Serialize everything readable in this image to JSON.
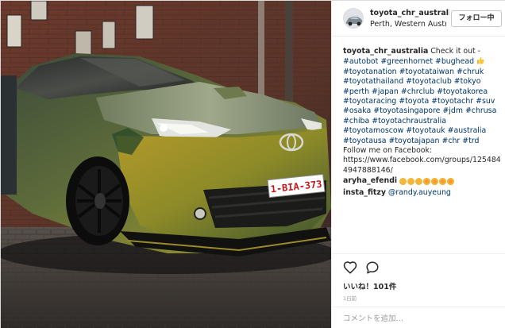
{
  "post": {
    "image_alt": "Toyota C-HR with color-shifting wrap and 1-BIA-373 plate",
    "plate_text": "1-BIA-373"
  },
  "header": {
    "username": "toyota_chr_australia",
    "location": "Perth, Western Australia",
    "follow_label": "フォロー中"
  },
  "caption": {
    "username": "toyota_chr_australia",
    "text_lead": "Check it out -",
    "tags_line": [
      "#autobot",
      "#greenhornet",
      "#bughead"
    ],
    "tags": [
      "#toyotanation",
      "#toyotataiwan",
      "#chruk",
      "#toyotathailand",
      "#toyotaclub",
      "#tokyo",
      "#perth",
      "#japan",
      "#chrclub",
      "#toyotakorea",
      "#toyotaracing",
      "#toyota",
      "#toyotachr",
      "#suv",
      "#osaka",
      "#toyotasingapore",
      "#jdm",
      "#chrusa",
      "#chiba",
      "#toyotachraustralia",
      "#toyotamoscow",
      "#toyotauk",
      "#australia",
      "#toyotausa",
      "#toyotajapan",
      "#chr",
      "#trd"
    ],
    "follow_text": "Follow me on Facebook:",
    "facebook_url": "https://www.facebook.com/groups/1254844947888146/"
  },
  "comments": [
    {
      "user": "aryha_efendi",
      "text": ""
    },
    {
      "user": "insta_fitzy",
      "text": "@randy.auyeung"
    }
  ],
  "actions": {
    "likes_text": "いいね！101件",
    "time_text": "1日前",
    "comment_placeholder": "コメントを追加…"
  },
  "colors": {
    "hashtag": "#003569",
    "text": "#262626",
    "muted": "#999999",
    "border": "#dbdbdb"
  },
  "icons": {
    "like": "heart-icon",
    "comment": "speech-bubble-icon"
  }
}
